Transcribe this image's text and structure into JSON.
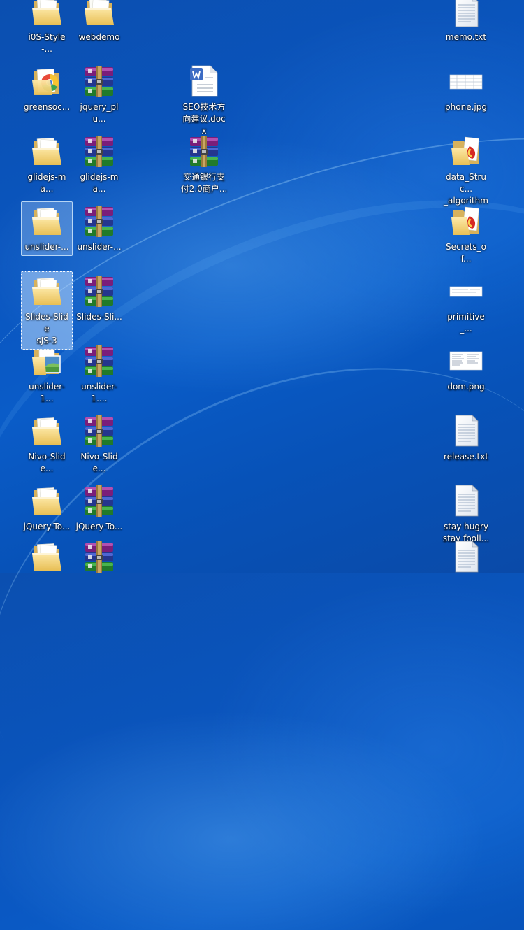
{
  "desktop": {
    "icons": [
      {
        "label": "i0S-Style-...",
        "icon": "folder-icon"
      },
      {
        "label": "webdemo",
        "icon": "folder-icon"
      },
      {
        "label": "memo.txt",
        "icon": "text-file-icon"
      },
      {
        "label": "greensoc...",
        "icon": "folder-chrome-icon"
      },
      {
        "label": "jquery_plu...",
        "icon": "winrar-archive-icon"
      },
      {
        "label": "SEO技术方\n向建议.docx",
        "icon": "word-document-icon"
      },
      {
        "label": "phone.jpg",
        "icon": "image-thumbnail-icon"
      },
      {
        "label": "glidejs-ma...",
        "icon": "folder-icon"
      },
      {
        "label": "glidejs-ma...",
        "icon": "winrar-archive-icon"
      },
      {
        "label": "交通银行支\n付2.0商户...",
        "icon": "winrar-archive-icon"
      },
      {
        "label": "data_Struc...\n_algorithm",
        "icon": "folder-pdf-icon"
      },
      {
        "label": "unslider-...",
        "icon": "folder-icon"
      },
      {
        "label": "unslider-...",
        "icon": "winrar-archive-icon"
      },
      {
        "label": "Secrets_of...",
        "icon": "folder-pdf-icon"
      },
      {
        "label": "Slides-Slide\nsJS-3",
        "icon": "folder-icon"
      },
      {
        "label": "Slides-Sli...",
        "icon": "winrar-archive-icon"
      },
      {
        "label": "primitive_...",
        "icon": "image-thumbnail-icon"
      },
      {
        "label": "unslider-1...",
        "icon": "folder-picture-icon"
      },
      {
        "label": "unslider-1....",
        "icon": "winrar-archive-icon"
      },
      {
        "label": "dom.png",
        "icon": "image-thumbnail-icon"
      },
      {
        "label": "Nivo-Slide...",
        "icon": "folder-icon"
      },
      {
        "label": "Nivo-Slide...",
        "icon": "winrar-archive-icon"
      },
      {
        "label": "release.txt",
        "icon": "text-file-icon"
      },
      {
        "label": "jQuery-To...",
        "icon": "folder-icon"
      },
      {
        "label": "jQuery-To...",
        "icon": "winrar-archive-icon"
      },
      {
        "label": "stay hugry\nstay fooli...",
        "icon": "text-file-icon"
      },
      {
        "label": "",
        "icon": "folder-icon"
      },
      {
        "label": "",
        "icon": "winrar-archive-icon"
      },
      {
        "label": "",
        "icon": "text-file-icon"
      }
    ]
  }
}
